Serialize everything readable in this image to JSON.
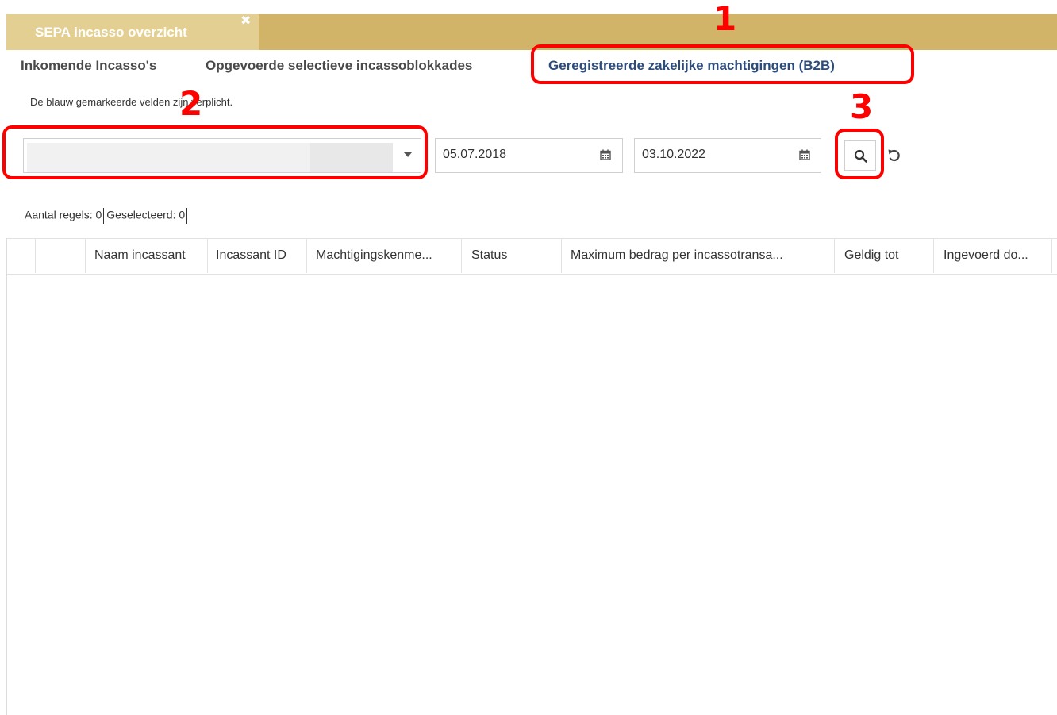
{
  "window": {
    "tab_title": "SEPA incasso overzicht",
    "close_glyph": "✖"
  },
  "subtabs": [
    {
      "label": "Inkomende Incasso's"
    },
    {
      "label": "Opgevoerde selectieve incassoblokkades"
    },
    {
      "label": "Geregistreerde zakelijke machtigingen (B2B)"
    }
  ],
  "hint": "De blauw gemarkeerde velden zijn verplicht.",
  "filters": {
    "account_select_value": "",
    "date_from": "05.07.2018",
    "date_to": "03.10.2022"
  },
  "counts": {
    "rows_label": "Aantal regels: 0",
    "selected_label": "Geselecteerd: 0"
  },
  "columns": [
    "Naam incassant",
    "Incassant ID",
    "Machtigingskenme...",
    "Status",
    "Maximum bedrag per incassotransa...",
    "Geldig tot",
    "Ingevoerd do..."
  ],
  "annotations": [
    "1",
    "2",
    "3"
  ],
  "colors": {
    "header_bar": "#d2b468",
    "active_tab": "#e3cf92",
    "active_subtab": "#2c4c7c",
    "annotation": "#ff0000"
  },
  "icons": [
    "close-icon",
    "chevron-down-icon",
    "calendar-icon",
    "search-icon",
    "reset-icon"
  ]
}
